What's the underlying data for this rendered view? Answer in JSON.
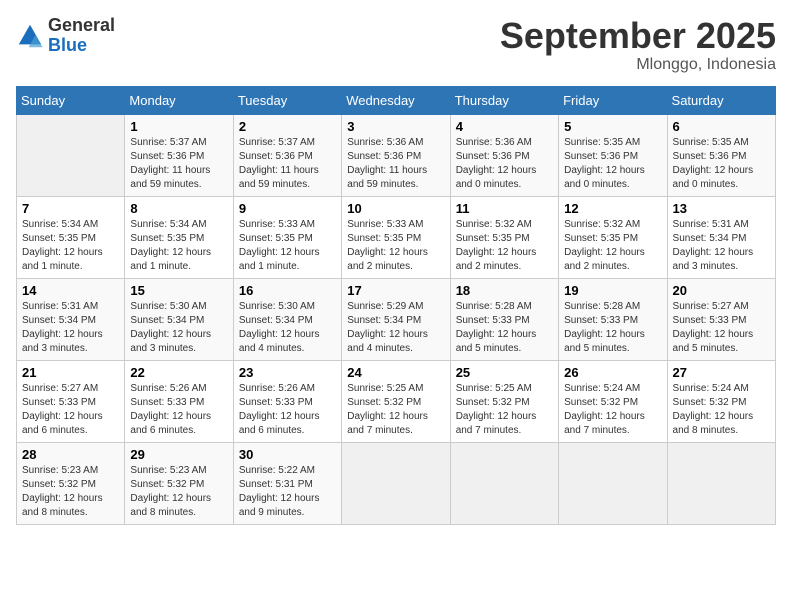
{
  "header": {
    "logo_general": "General",
    "logo_blue": "Blue",
    "month_title": "September 2025",
    "location": "Mlonggo, Indonesia"
  },
  "weekdays": [
    "Sunday",
    "Monday",
    "Tuesday",
    "Wednesday",
    "Thursday",
    "Friday",
    "Saturday"
  ],
  "weeks": [
    [
      {
        "day": "",
        "info": ""
      },
      {
        "day": "1",
        "info": "Sunrise: 5:37 AM\nSunset: 5:36 PM\nDaylight: 11 hours\nand 59 minutes."
      },
      {
        "day": "2",
        "info": "Sunrise: 5:37 AM\nSunset: 5:36 PM\nDaylight: 11 hours\nand 59 minutes."
      },
      {
        "day": "3",
        "info": "Sunrise: 5:36 AM\nSunset: 5:36 PM\nDaylight: 11 hours\nand 59 minutes."
      },
      {
        "day": "4",
        "info": "Sunrise: 5:36 AM\nSunset: 5:36 PM\nDaylight: 12 hours\nand 0 minutes."
      },
      {
        "day": "5",
        "info": "Sunrise: 5:35 AM\nSunset: 5:36 PM\nDaylight: 12 hours\nand 0 minutes."
      },
      {
        "day": "6",
        "info": "Sunrise: 5:35 AM\nSunset: 5:36 PM\nDaylight: 12 hours\nand 0 minutes."
      }
    ],
    [
      {
        "day": "7",
        "info": "Sunrise: 5:34 AM\nSunset: 5:35 PM\nDaylight: 12 hours\nand 1 minute."
      },
      {
        "day": "8",
        "info": "Sunrise: 5:34 AM\nSunset: 5:35 PM\nDaylight: 12 hours\nand 1 minute."
      },
      {
        "day": "9",
        "info": "Sunrise: 5:33 AM\nSunset: 5:35 PM\nDaylight: 12 hours\nand 1 minute."
      },
      {
        "day": "10",
        "info": "Sunrise: 5:33 AM\nSunset: 5:35 PM\nDaylight: 12 hours\nand 2 minutes."
      },
      {
        "day": "11",
        "info": "Sunrise: 5:32 AM\nSunset: 5:35 PM\nDaylight: 12 hours\nand 2 minutes."
      },
      {
        "day": "12",
        "info": "Sunrise: 5:32 AM\nSunset: 5:35 PM\nDaylight: 12 hours\nand 2 minutes."
      },
      {
        "day": "13",
        "info": "Sunrise: 5:31 AM\nSunset: 5:34 PM\nDaylight: 12 hours\nand 3 minutes."
      }
    ],
    [
      {
        "day": "14",
        "info": "Sunrise: 5:31 AM\nSunset: 5:34 PM\nDaylight: 12 hours\nand 3 minutes."
      },
      {
        "day": "15",
        "info": "Sunrise: 5:30 AM\nSunset: 5:34 PM\nDaylight: 12 hours\nand 3 minutes."
      },
      {
        "day": "16",
        "info": "Sunrise: 5:30 AM\nSunset: 5:34 PM\nDaylight: 12 hours\nand 4 minutes."
      },
      {
        "day": "17",
        "info": "Sunrise: 5:29 AM\nSunset: 5:34 PM\nDaylight: 12 hours\nand 4 minutes."
      },
      {
        "day": "18",
        "info": "Sunrise: 5:28 AM\nSunset: 5:33 PM\nDaylight: 12 hours\nand 5 minutes."
      },
      {
        "day": "19",
        "info": "Sunrise: 5:28 AM\nSunset: 5:33 PM\nDaylight: 12 hours\nand 5 minutes."
      },
      {
        "day": "20",
        "info": "Sunrise: 5:27 AM\nSunset: 5:33 PM\nDaylight: 12 hours\nand 5 minutes."
      }
    ],
    [
      {
        "day": "21",
        "info": "Sunrise: 5:27 AM\nSunset: 5:33 PM\nDaylight: 12 hours\nand 6 minutes."
      },
      {
        "day": "22",
        "info": "Sunrise: 5:26 AM\nSunset: 5:33 PM\nDaylight: 12 hours\nand 6 minutes."
      },
      {
        "day": "23",
        "info": "Sunrise: 5:26 AM\nSunset: 5:33 PM\nDaylight: 12 hours\nand 6 minutes."
      },
      {
        "day": "24",
        "info": "Sunrise: 5:25 AM\nSunset: 5:32 PM\nDaylight: 12 hours\nand 7 minutes."
      },
      {
        "day": "25",
        "info": "Sunrise: 5:25 AM\nSunset: 5:32 PM\nDaylight: 12 hours\nand 7 minutes."
      },
      {
        "day": "26",
        "info": "Sunrise: 5:24 AM\nSunset: 5:32 PM\nDaylight: 12 hours\nand 7 minutes."
      },
      {
        "day": "27",
        "info": "Sunrise: 5:24 AM\nSunset: 5:32 PM\nDaylight: 12 hours\nand 8 minutes."
      }
    ],
    [
      {
        "day": "28",
        "info": "Sunrise: 5:23 AM\nSunset: 5:32 PM\nDaylight: 12 hours\nand 8 minutes."
      },
      {
        "day": "29",
        "info": "Sunrise: 5:23 AM\nSunset: 5:32 PM\nDaylight: 12 hours\nand 8 minutes."
      },
      {
        "day": "30",
        "info": "Sunrise: 5:22 AM\nSunset: 5:31 PM\nDaylight: 12 hours\nand 9 minutes."
      },
      {
        "day": "",
        "info": ""
      },
      {
        "day": "",
        "info": ""
      },
      {
        "day": "",
        "info": ""
      },
      {
        "day": "",
        "info": ""
      }
    ]
  ]
}
